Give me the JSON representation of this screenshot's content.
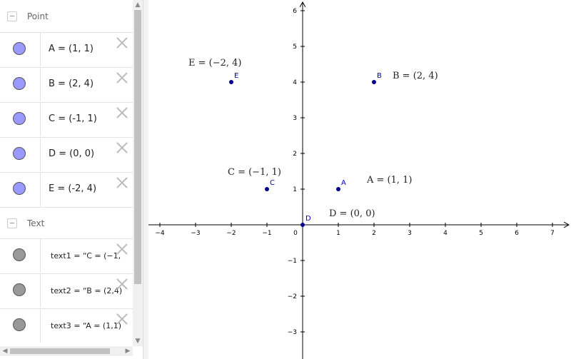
{
  "algebra": {
    "groups": [
      {
        "title": "Point",
        "items": [
          {
            "label": "A = (1, 1)"
          },
          {
            "label": "B = (2, 4)"
          },
          {
            "label": "C = (-1, 1)"
          },
          {
            "label": "D = (0, 0)"
          },
          {
            "label": "E = (-2, 4)"
          }
        ]
      },
      {
        "title": "Text",
        "items": [
          {
            "label": "text1 = “C = (−1,"
          },
          {
            "label": "text2 = “B = (2,4)"
          },
          {
            "label": "text3 = “A = (1,1)"
          }
        ]
      }
    ]
  },
  "colors": {
    "point_marble": "#9999ff",
    "text_marble": "#999999",
    "point": "#00008b",
    "point_label": "#0000cc"
  },
  "graphics": {
    "x_ticks": [
      "−4",
      "−3",
      "−2",
      "−1",
      "0",
      "1",
      "2",
      "3",
      "4",
      "5",
      "6",
      "7"
    ],
    "y_ticks_pos": [
      "1",
      "2",
      "3",
      "4",
      "5",
      "6"
    ],
    "y_ticks_neg": [
      "−1",
      "−2",
      "−3"
    ],
    "points": [
      {
        "name": "A",
        "x": 1,
        "y": 1
      },
      {
        "name": "B",
        "x": 2,
        "y": 4
      },
      {
        "name": "C",
        "x": -1,
        "y": 1
      },
      {
        "name": "D",
        "x": 0,
        "y": 0
      },
      {
        "name": "E",
        "x": -2,
        "y": 4
      }
    ],
    "texts": [
      {
        "id": "text1",
        "content": "C = (−1, 1)"
      },
      {
        "id": "text2",
        "content": "B = (2, 4)"
      },
      {
        "id": "text3",
        "content": "A = (1, 1)"
      },
      {
        "id": "text4",
        "content": "D = (0, 0)"
      },
      {
        "id": "text5",
        "content": "E = (−2, 4)"
      }
    ]
  }
}
